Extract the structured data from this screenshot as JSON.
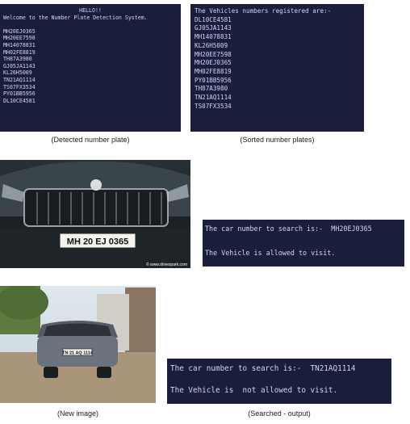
{
  "terminal_detected": {
    "title": "HELLO!!",
    "welcome": "Welcome to the Number Plate Detection System.",
    "plates": [
      "MH20EJ0365",
      "MH20EE7598",
      "MH14078831",
      "MH02FE8819",
      "TH87A3980",
      "GJ05JA1143",
      "KL26H5009",
      "TN21AQ1114",
      "TS07FX3534",
      "PY01BB5956",
      "DL10CE4581"
    ]
  },
  "terminal_sorted": {
    "header": "The Vehicles numbers registered are:-",
    "plates": [
      "DL10CE4581",
      "GJ05JA1143",
      "MH14078831",
      "KL26H5009",
      "MH20EE7598",
      "MH20EJ0365",
      "MH02FE8819",
      "PY01BB5956",
      "TH87A3980",
      "TN21AQ1114",
      "TS07FX3534"
    ]
  },
  "captions": {
    "detected": "(Detected number plate)",
    "sorted": "(Sorted number plates)",
    "new_image": "(New image)",
    "searched": "(Searched - output)"
  },
  "photo1": {
    "plate": "MH 20 EJ 0365",
    "watermark": "© www.drivespark.com"
  },
  "photo2": {
    "plate": "TN 21 AQ 1114"
  },
  "search1": {
    "query": "The car number to search is:-  MH20EJ0365",
    "result": "The Vehicle is allowed to visit."
  },
  "search2": {
    "query": "The car number to search is:-  TN21AQ1114",
    "result": "The Vehicle is  not allowed to visit."
  }
}
